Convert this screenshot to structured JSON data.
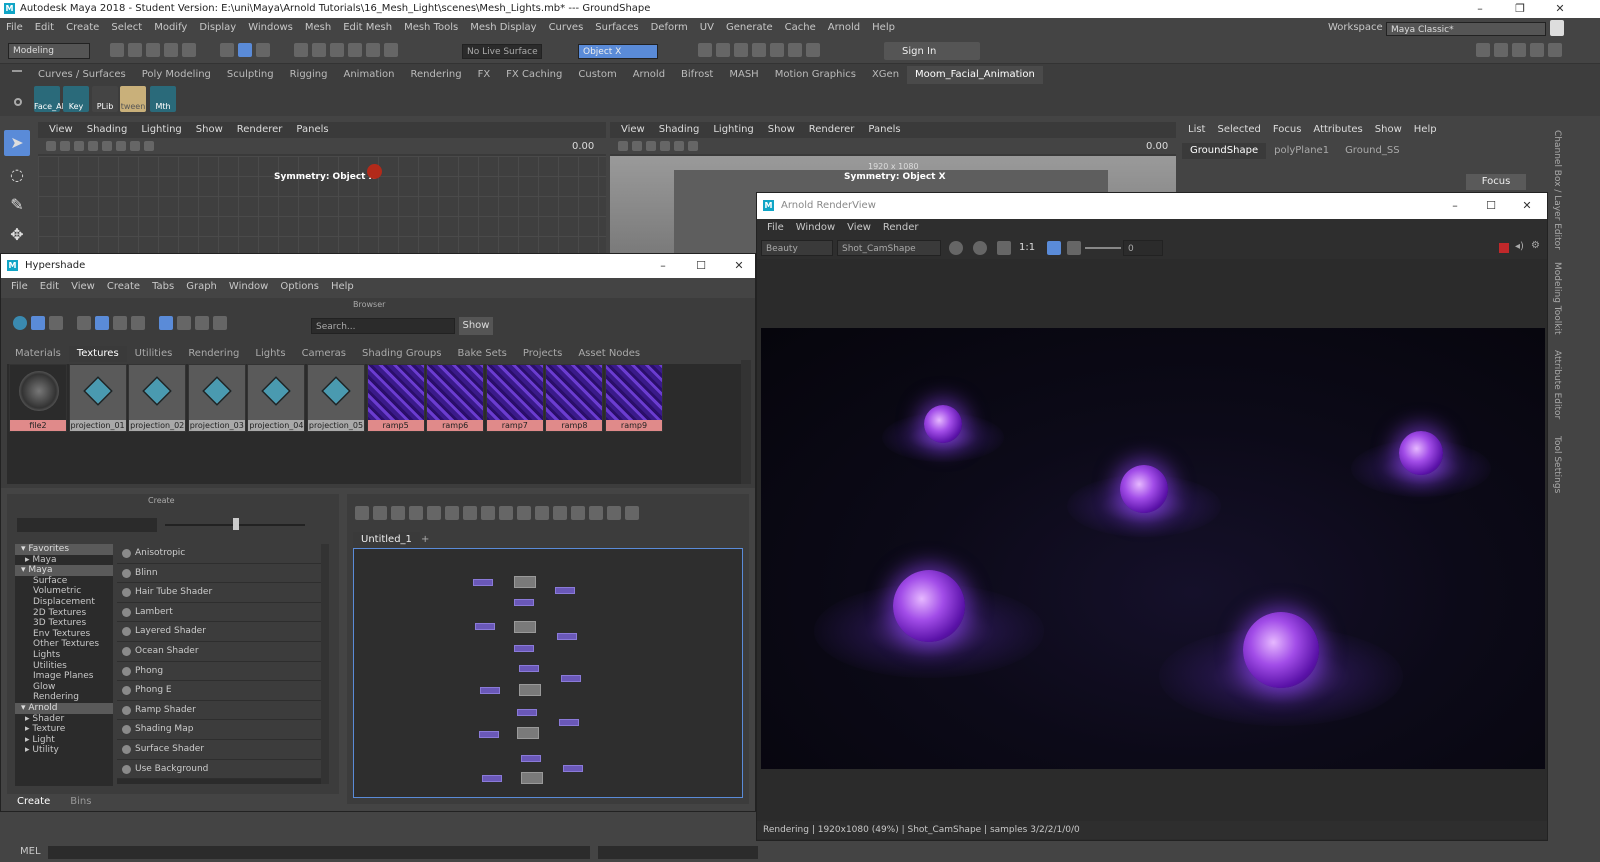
{
  "app": {
    "title": "Autodesk Maya 2018 - Student Version: E:\\uni\\Maya\\Arnold Tutorials\\16_Mesh_Light\\scenes\\Mesh_Lights.mb*  ---  GroundShape",
    "menus": [
      "File",
      "Edit",
      "Create",
      "Select",
      "Modify",
      "Display",
      "Windows",
      "Mesh",
      "Edit Mesh",
      "Mesh Tools",
      "Mesh Display",
      "Curves",
      "Surfaces",
      "Deform",
      "UV",
      "Generate",
      "Cache",
      "Arnold",
      "Help"
    ],
    "workspace_label": "Workspace :",
    "workspace_value": "Maya Classic*"
  },
  "status": {
    "mode": "Modeling",
    "live_surface": "No Live Surface",
    "symmetry_field": "Object X",
    "sign_in": "Sign In"
  },
  "shelf": {
    "tabs": [
      "Curves / Surfaces",
      "Poly Modeling",
      "Sculpting",
      "Rigging",
      "Animation",
      "Rendering",
      "FX",
      "FX Caching",
      "Custom",
      "Arnold",
      "Bifrost",
      "MASH",
      "Motion Graphics",
      "XGen",
      "Moom_Facial_Animation"
    ],
    "active_tab": "Moom_Facial_Animation",
    "icons": [
      "Face_AI",
      "Key",
      "PLib",
      "tween",
      "Mth"
    ]
  },
  "viewport_left": {
    "menus": [
      "View",
      "Shading",
      "Lighting",
      "Show",
      "Renderer",
      "Panels"
    ],
    "value": "0.00",
    "symmetry_label": "Symmetry: Object X"
  },
  "viewport_right": {
    "menus": [
      "View",
      "Shading",
      "Lighting",
      "Show",
      "Renderer",
      "Panels"
    ],
    "value": "0.00",
    "resolution": "1920 x 1080",
    "symmetry_label": "Symmetry: Object X"
  },
  "attribute_editor": {
    "menus": [
      "List",
      "Selected",
      "Focus",
      "Attributes",
      "Show",
      "Help"
    ],
    "tabs": [
      "GroundShape",
      "polyPlane1",
      "Ground_SS"
    ],
    "focus_button": "Focus",
    "side_tabs": [
      "Channel Box / Layer Editor",
      "Modeling Toolkit",
      "Attribute Editor",
      "Tool Settings"
    ]
  },
  "hypershade": {
    "title": "Hypershade",
    "menus": [
      "File",
      "Edit",
      "View",
      "Create",
      "Tabs",
      "Graph",
      "Window",
      "Options",
      "Help"
    ],
    "browser_label": "Browser",
    "search_placeholder": "Search...",
    "show_button": "Show",
    "browser_tabs": [
      "Materials",
      "Textures",
      "Utilities",
      "Rendering",
      "Lights",
      "Cameras",
      "Shading Groups",
      "Bake Sets",
      "Projects",
      "Asset Nodes"
    ],
    "active_browser_tab": "Textures",
    "swatches": [
      {
        "label": "file2",
        "kind": "file"
      },
      {
        "label": "projection_01",
        "kind": "projection"
      },
      {
        "label": "projection_02",
        "kind": "projection"
      },
      {
        "label": "projection_03",
        "kind": "projection"
      },
      {
        "label": "projection_04",
        "kind": "projection"
      },
      {
        "label": "projection_05",
        "kind": "projection"
      },
      {
        "label": "ramp5",
        "kind": "ramp"
      },
      {
        "label": "ramp6",
        "kind": "ramp"
      },
      {
        "label": "ramp7",
        "kind": "ramp"
      },
      {
        "label": "ramp8",
        "kind": "ramp"
      },
      {
        "label": "ramp9",
        "kind": "ramp"
      }
    ],
    "create_label": "Create",
    "tree": [
      {
        "label": "Favorites",
        "type": "hdr"
      },
      {
        "label": "Maya",
        "type": "sub"
      },
      {
        "label": "Maya",
        "type": "hdr"
      },
      {
        "label": "Surface",
        "type": "item"
      },
      {
        "label": "Volumetric",
        "type": "item"
      },
      {
        "label": "Displacement",
        "type": "item"
      },
      {
        "label": "2D Textures",
        "type": "item"
      },
      {
        "label": "3D Textures",
        "type": "item"
      },
      {
        "label": "Env Textures",
        "type": "item"
      },
      {
        "label": "Other Textures",
        "type": "item"
      },
      {
        "label": "Lights",
        "type": "item"
      },
      {
        "label": "Utilities",
        "type": "item"
      },
      {
        "label": "Image Planes",
        "type": "item"
      },
      {
        "label": "Glow",
        "type": "item"
      },
      {
        "label": "Rendering",
        "type": "item"
      },
      {
        "label": "Arnold",
        "type": "hdr"
      },
      {
        "label": "Shader",
        "type": "sub"
      },
      {
        "label": "Texture",
        "type": "sub"
      },
      {
        "label": "Light",
        "type": "sub"
      },
      {
        "label": "Utility",
        "type": "sub"
      }
    ],
    "shaders": [
      "Anisotropic",
      "Blinn",
      "Hair Tube Shader",
      "Lambert",
      "Layered Shader",
      "Ocean Shader",
      "Phong",
      "Phong E",
      "Ramp Shader",
      "Shading Map",
      "Surface Shader",
      "Use Background"
    ],
    "graph_tab": "Untitled_1",
    "graph_tab_add": "+",
    "bottom_tabs": [
      "Create",
      "Bins"
    ]
  },
  "render_view": {
    "title": "Arnold RenderView",
    "menus": [
      "File",
      "Window",
      "View",
      "Render"
    ],
    "aov": "Beauty",
    "camera": "Shot_CamShape",
    "ratio": "1:1",
    "exposure": "0",
    "status": "Rendering | 1920x1080 (49%) | Shot_CamShape | samples 3/2/2/1/0/0"
  },
  "commandline": {
    "lang": "MEL"
  }
}
